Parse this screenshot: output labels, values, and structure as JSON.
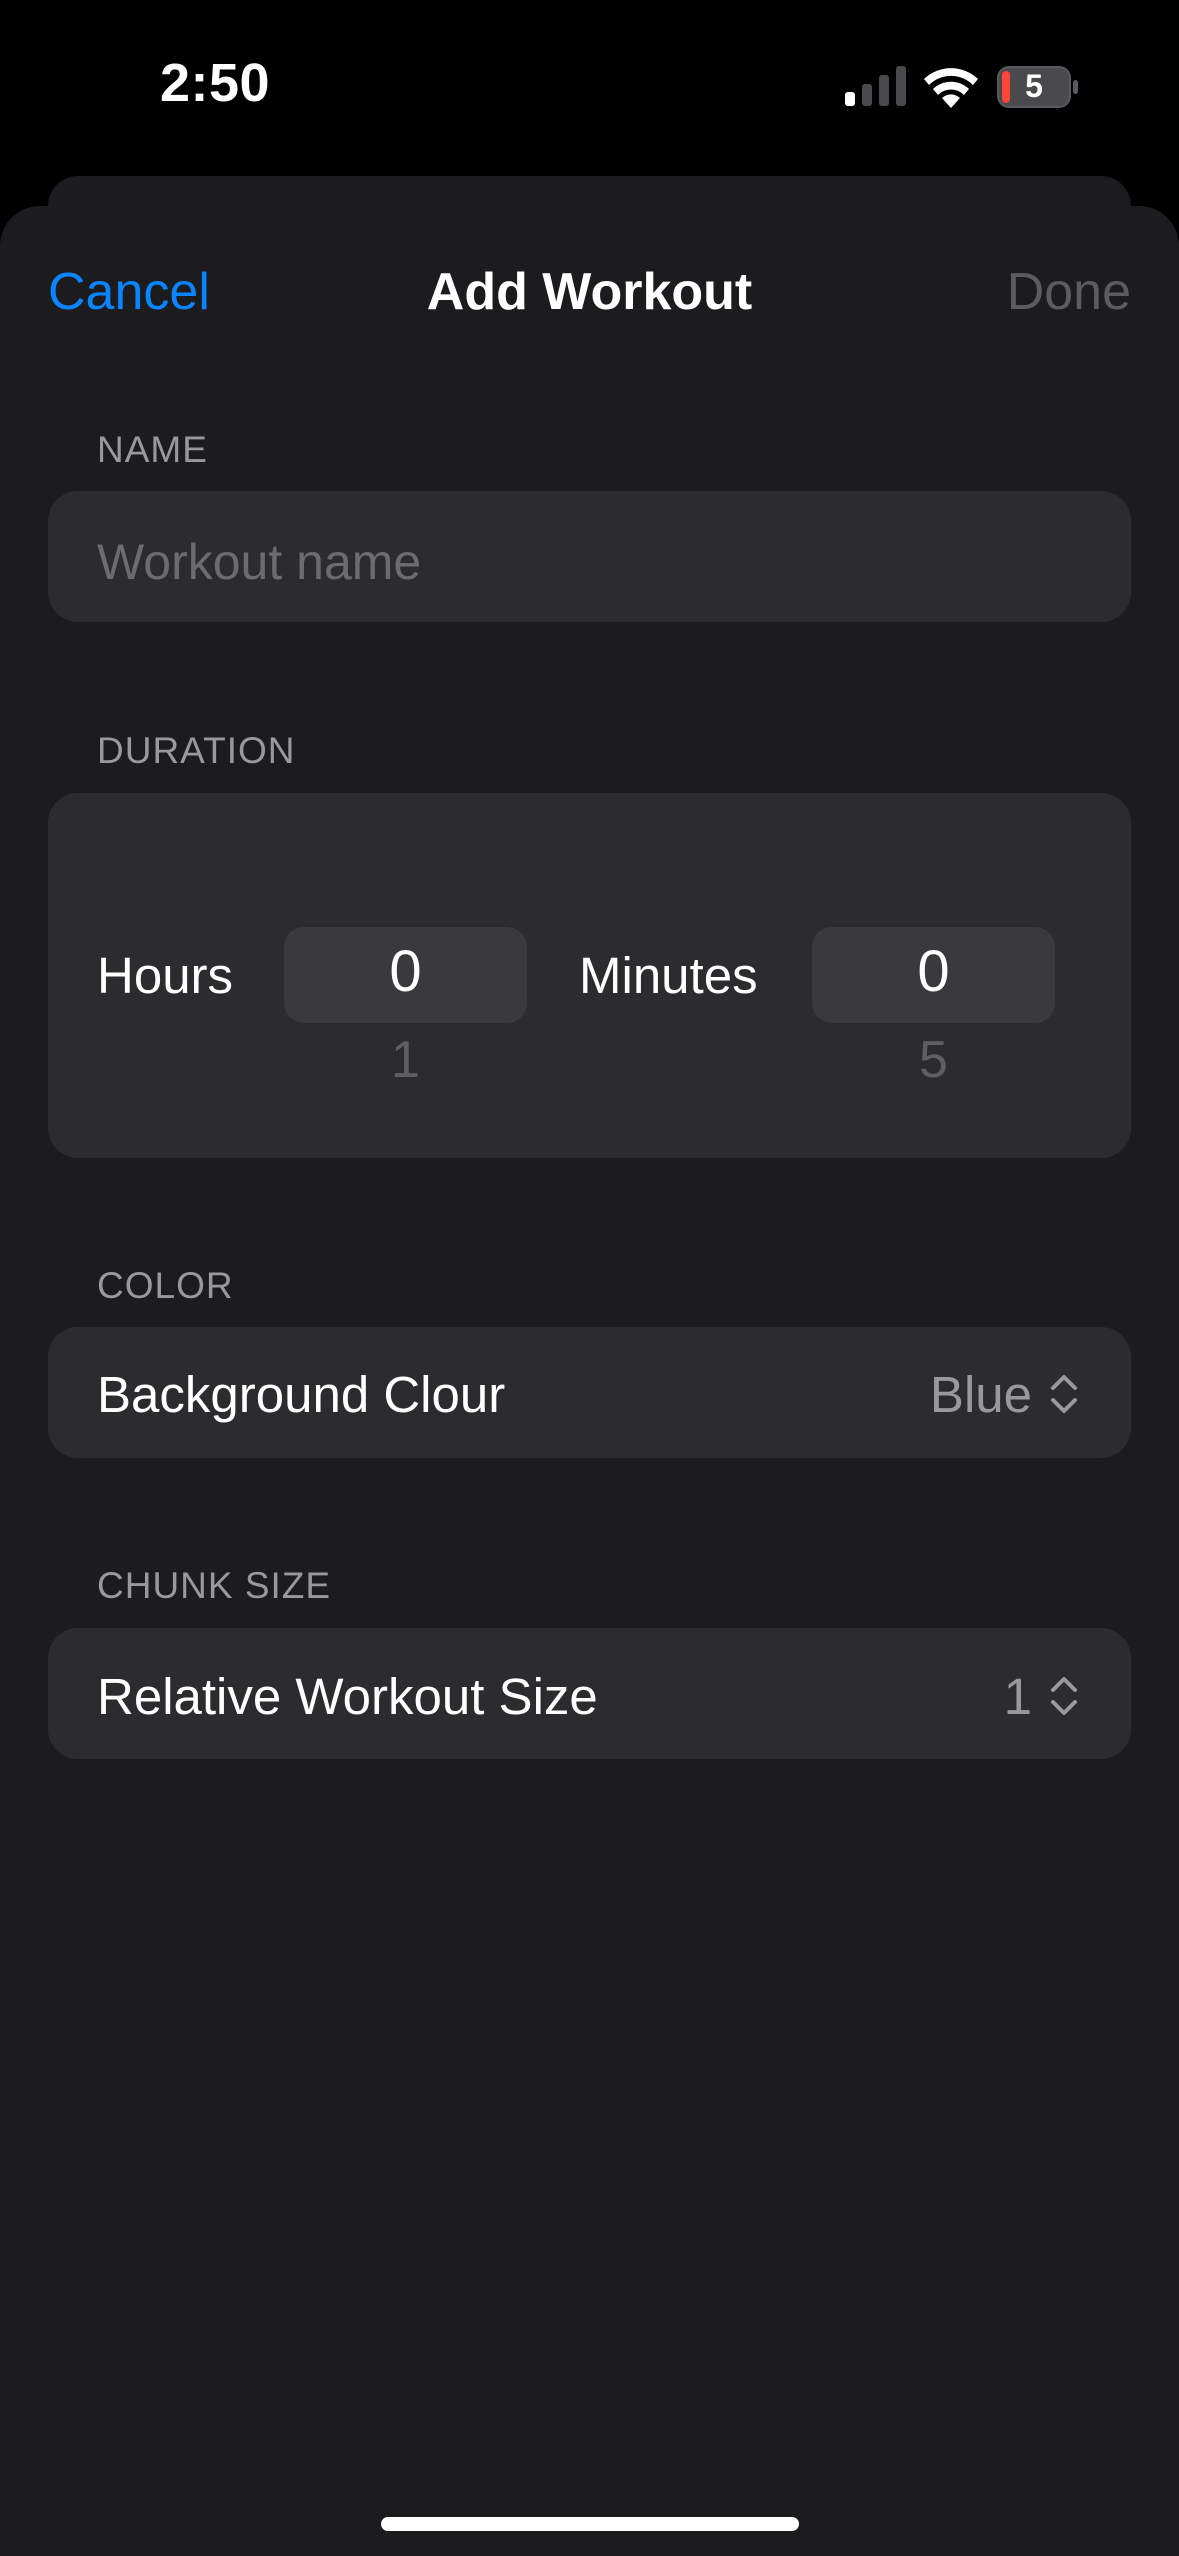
{
  "status_bar": {
    "time": "2:50",
    "battery_level": "5",
    "icons": [
      "cellular-signal-icon",
      "wifi-icon",
      "battery-icon"
    ]
  },
  "nav": {
    "cancel": "Cancel",
    "title": "Add Workout",
    "done": "Done"
  },
  "sections": {
    "name": {
      "header": "NAME",
      "placeholder": "Workout name",
      "value": ""
    },
    "duration": {
      "header": "DURATION",
      "hours_label": "Hours",
      "hours_value": "0",
      "hours_next": "1",
      "minutes_label": "Minutes",
      "minutes_value": "0",
      "minutes_next": "5"
    },
    "color": {
      "header": "COLOR",
      "label": "Background Clour",
      "value": "Blue"
    },
    "chunk": {
      "header": "CHUNK SIZE",
      "label": "Relative Workout Size",
      "value": "1"
    }
  },
  "colors": {
    "accent": "#0a84ff",
    "sheet_bg": "#1c1c1e",
    "card_bg": "#2c2c2e",
    "secondary_text": "#98989f",
    "disabled_text": "#5b5b60"
  }
}
